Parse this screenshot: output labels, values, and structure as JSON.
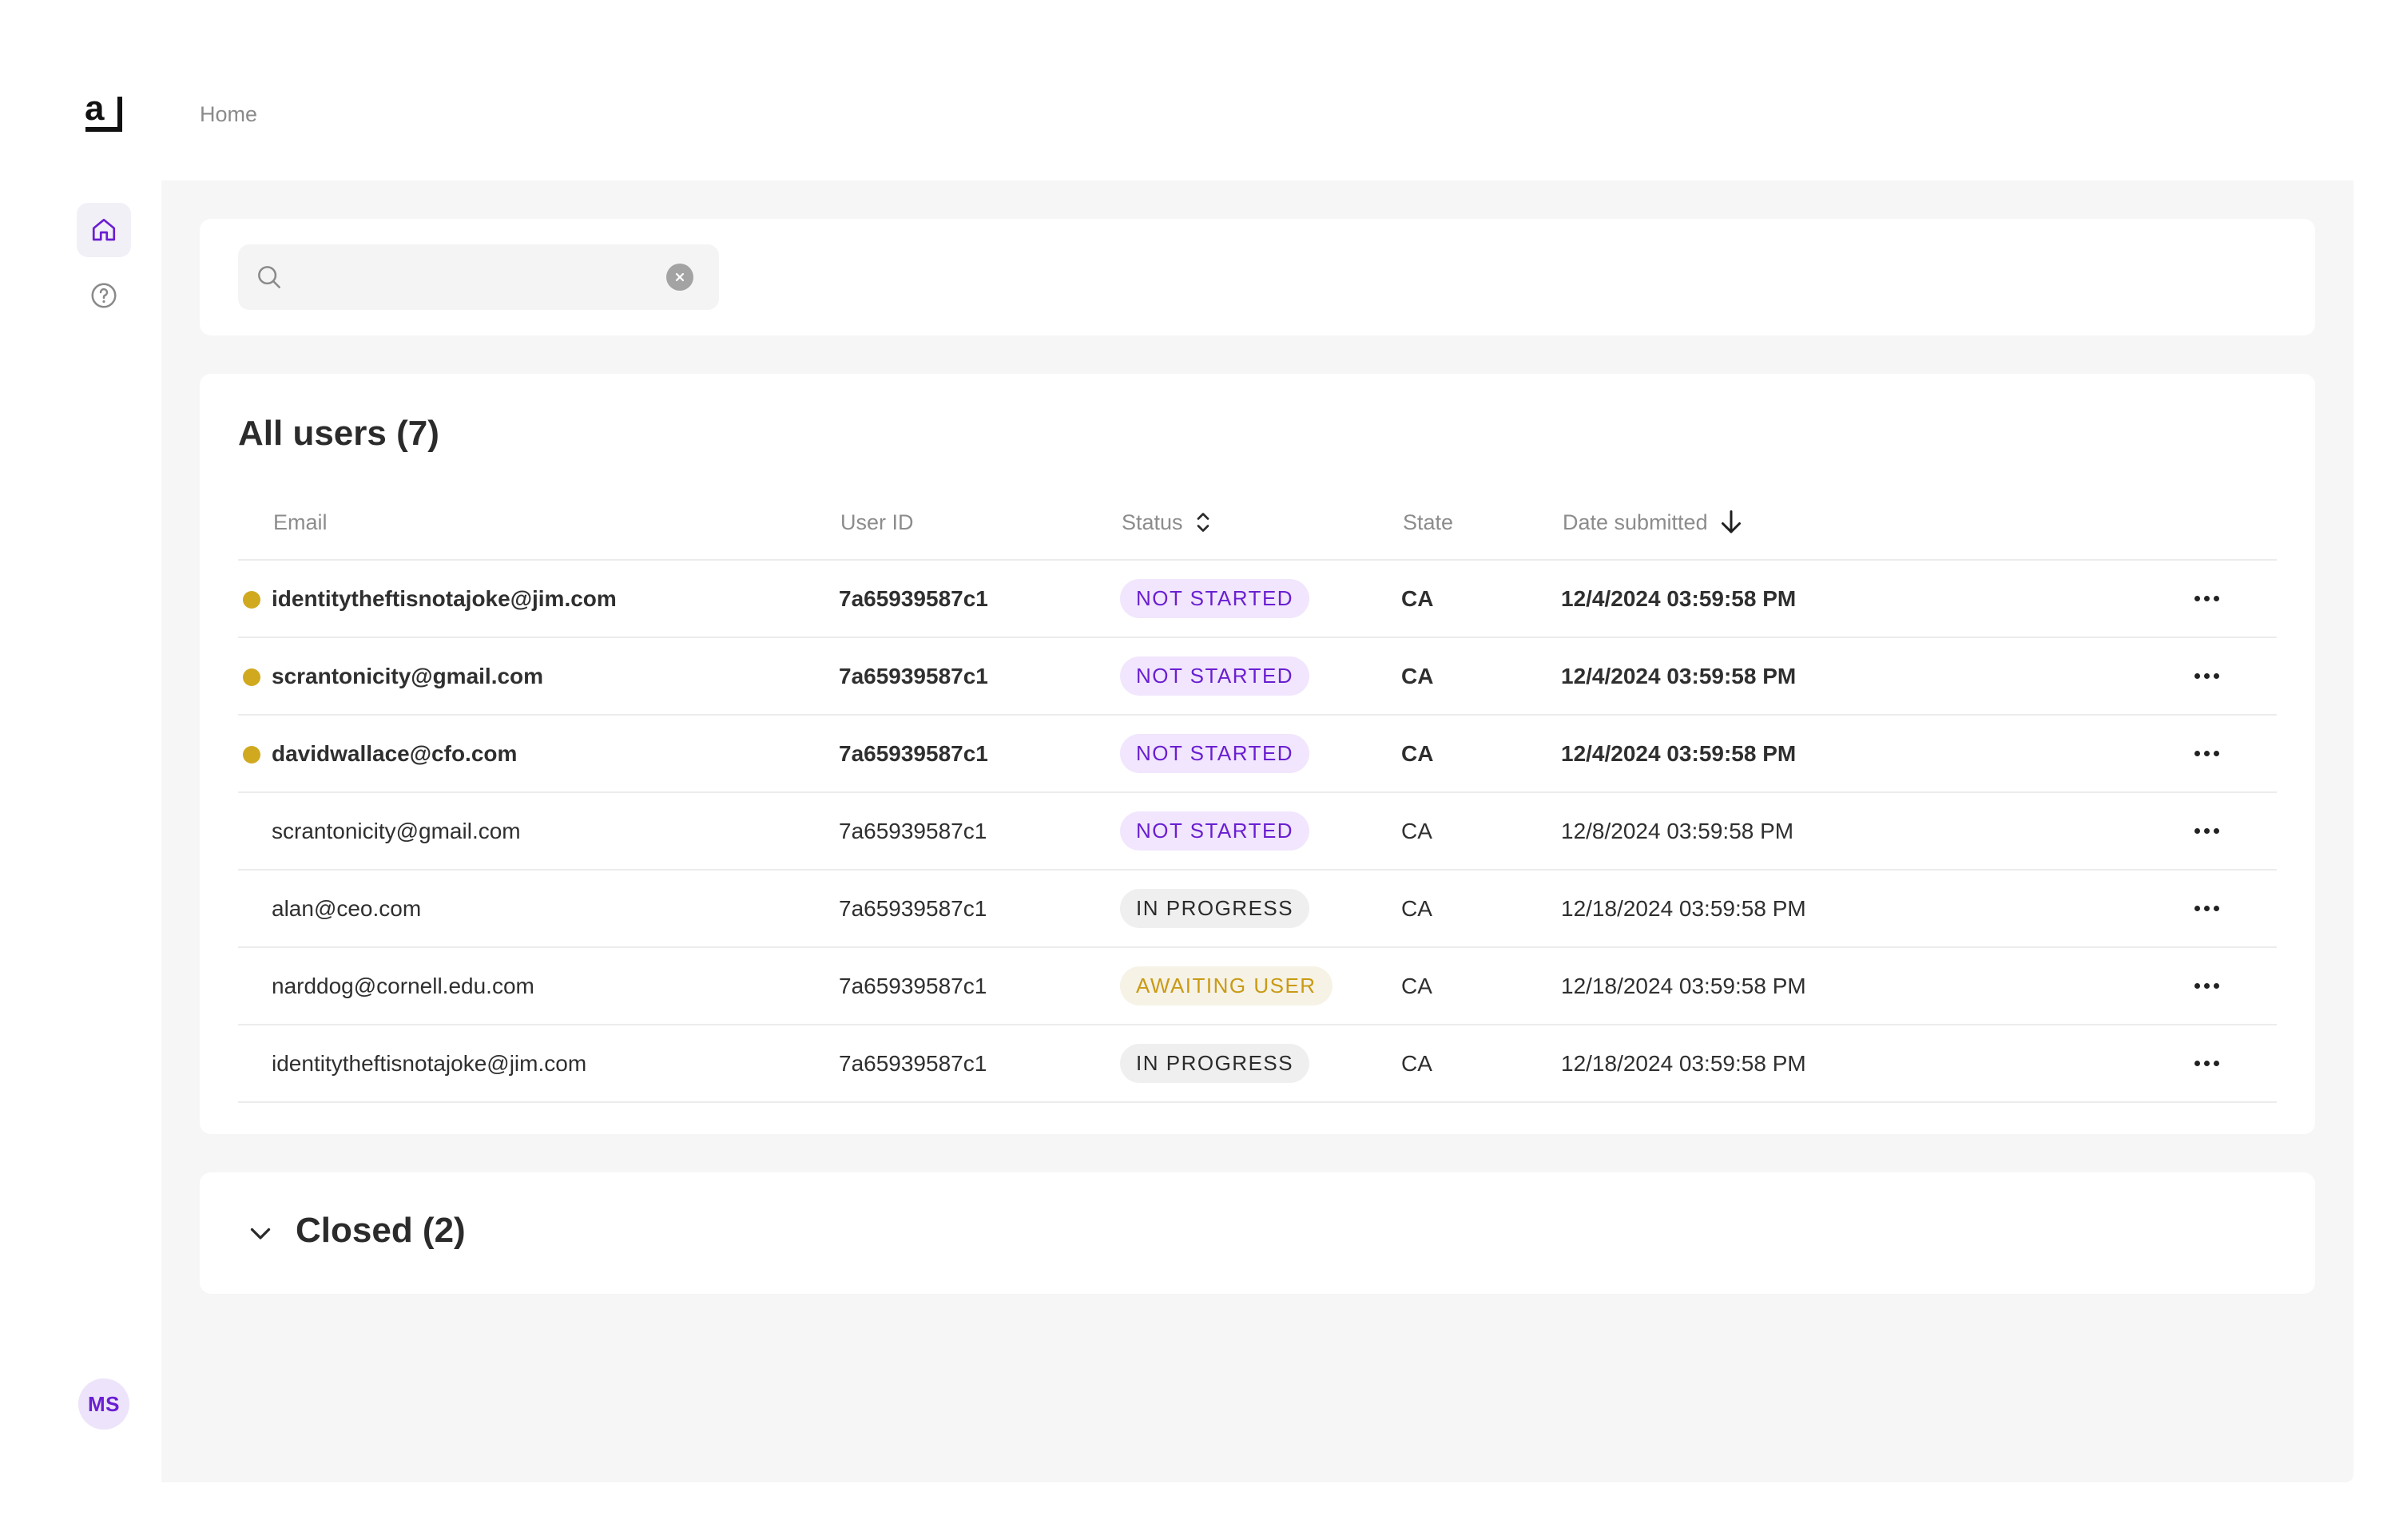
{
  "logo": {
    "text": "a"
  },
  "breadcrumb": "Home",
  "sidebar": {
    "items": [
      {
        "name": "home",
        "icon": "home-icon",
        "active": true
      },
      {
        "name": "help",
        "icon": "help-icon",
        "active": false
      }
    ],
    "avatar_initials": "MS"
  },
  "search": {
    "value": "",
    "placeholder": ""
  },
  "users": {
    "title": "All users (7)",
    "columns": {
      "email": "Email",
      "user_id": "User ID",
      "status": "Status",
      "state": "State",
      "date": "Date submitted"
    },
    "rows": [
      {
        "email": "identitytheftisnotajoke@jim.com",
        "user_id": "7a65939587c1",
        "status": "NOT STARTED",
        "state": "CA",
        "date": "12/4/2024 03:59:58 PM"
      },
      {
        "email": "scrantonicity@gmail.com",
        "user_id": "7a65939587c1",
        "status": "NOT STARTED",
        "state": "CA",
        "date": "12/4/2024 03:59:58 PM"
      },
      {
        "email": "davidwallace@cfo.com",
        "user_id": "7a65939587c1",
        "status": "NOT STARTED",
        "state": "CA",
        "date": "12/4/2024 03:59:58 PM"
      },
      {
        "email": "scrantonicity@gmail.com",
        "user_id": "7a65939587c1",
        "status": "NOT STARTED",
        "state": "CA",
        "date": "12/8/2024 03:59:58 PM"
      },
      {
        "email": "alan@ceo.com",
        "user_id": "7a65939587c1",
        "status": "IN PROGRESS",
        "state": "CA",
        "date": "12/18/2024 03:59:58 PM"
      },
      {
        "email": "narddog@cornell.edu.com",
        "user_id": "7a65939587c1",
        "status": "AWAITING USER",
        "state": "CA",
        "date": "12/18/2024 03:59:58 PM"
      },
      {
        "email": "identitytheftisnotajoke@jim.com",
        "user_id": "7a65939587c1",
        "status": "IN PROGRESS",
        "state": "CA",
        "date": "12/18/2024 03:59:58 PM"
      }
    ]
  },
  "closed": {
    "title": "Closed (2)"
  },
  "colors": {
    "accent": "#6a1fd1",
    "unread_dot": "#d1a91f",
    "badge_not_started_bg": "#f1e6fd",
    "badge_in_progress_bg": "#efefef",
    "badge_awaiting_text": "#c99a14"
  }
}
